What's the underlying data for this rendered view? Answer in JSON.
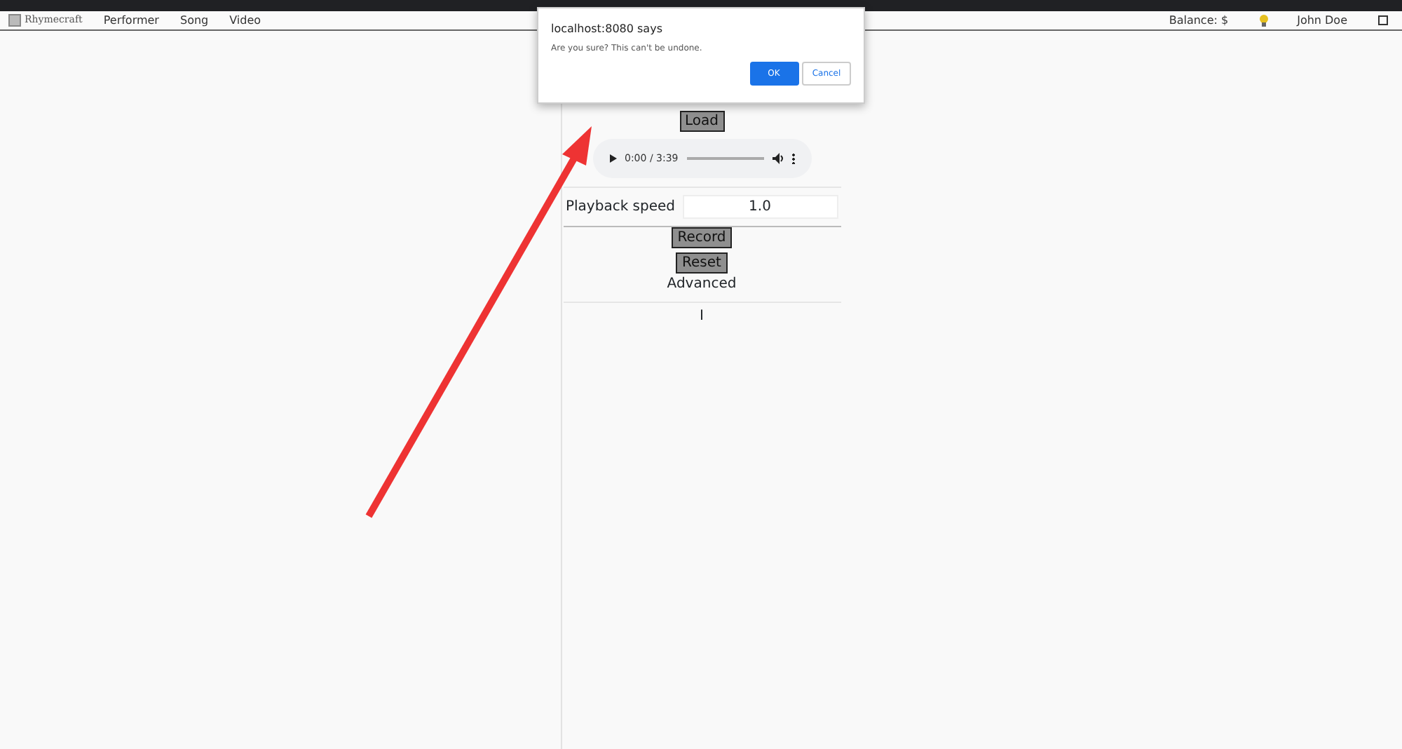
{
  "navbar": {
    "logo": "Rhymecraft",
    "links": [
      "Performer",
      "Song",
      "Video"
    ],
    "balance": "Balance: $",
    "user": "John Doe"
  },
  "main": {
    "load_button": "Load",
    "audio": {
      "time": "0:00 / 3:39"
    },
    "speed": {
      "label": "Playback speed",
      "value": "1.0"
    },
    "record_button": "Record",
    "reset_button": "Reset",
    "advanced": "Advanced",
    "column_text": "I"
  },
  "dialog": {
    "title": "localhost:8080 says",
    "message": "Are you sure? This can't be undone.",
    "ok": "OK",
    "cancel": "Cancel"
  }
}
